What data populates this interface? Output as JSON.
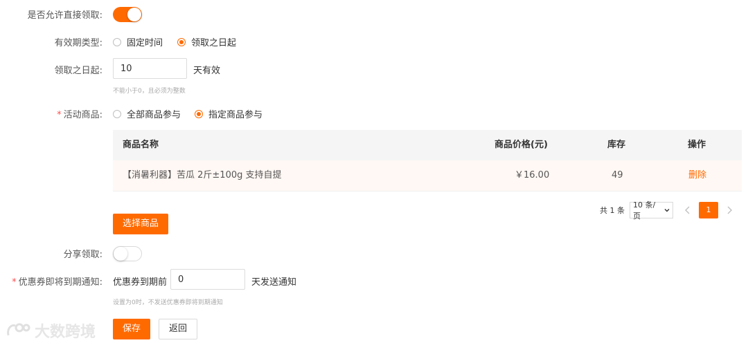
{
  "form": {
    "allow_direct_claim": {
      "label": "是否允许直接领取:",
      "enabled": true
    },
    "validity_type": {
      "label": "有效期类型:",
      "options": [
        "固定时间",
        "领取之日起"
      ],
      "selected": "领取之日起"
    },
    "from_claim_date": {
      "label": "领取之日起:",
      "value": "10",
      "suffix": "天有效",
      "hint": "不能小于0，且必须为整数"
    },
    "activity_products": {
      "label": "活动商品:",
      "required_mark": "*",
      "options": [
        "全部商品参与",
        "指定商品参与"
      ],
      "selected": "指定商品参与"
    },
    "product_table": {
      "headers": {
        "name": "商品名称",
        "price": "商品价格(元)",
        "stock": "库存",
        "action": "操作"
      },
      "rows": [
        {
          "name": "【消暑利器】苦瓜 2斤±100g 支持自提",
          "price": "￥16.00",
          "stock": "49",
          "action": "删除"
        }
      ]
    },
    "pagination": {
      "total": "共 1 条",
      "page_size": "10 条/页",
      "current_page": "1",
      "prev_icon": "chevron-left-icon",
      "next_icon": "chevron-right-icon"
    },
    "select_products_button": "选择商品",
    "share_claim": {
      "label": "分享领取:",
      "enabled": false
    },
    "expiry_notice": {
      "label": "优惠券即将到期通知:",
      "required_mark": "*",
      "prefix": "优惠券到期前",
      "value": "0",
      "suffix": "天发送通知",
      "hint": "设置为0时，不发送优惠券即将到期通知"
    }
  },
  "actions": {
    "save": "保存",
    "back": "返回"
  },
  "watermark": {
    "text": "大数跨境",
    "icon": "logo-icon"
  },
  "colors": {
    "accent": "#ff6a00",
    "required": "#ff4d4f"
  }
}
